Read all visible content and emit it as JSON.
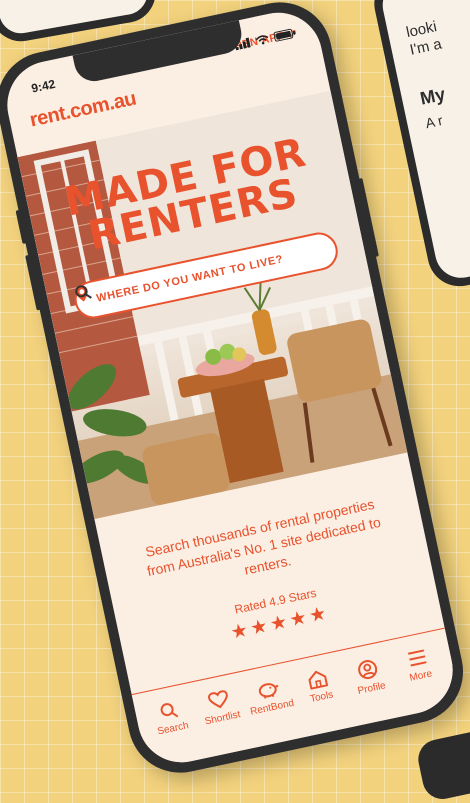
{
  "status": {
    "time": "9:42"
  },
  "header": {
    "logo": "rent.com.au",
    "open_app": "OPEN APP ↗"
  },
  "hero": {
    "headline_line1": "MADE FOR",
    "headline_line2": "RENTERS",
    "search_placeholder": "WHERE DO YOU WANT TO LIVE?"
  },
  "content": {
    "tagline": "Search thousands of rental properties from Australia's No. 1 site dedicated to renters.",
    "rating": "Rated 4.9 Stars",
    "stars": "★★★★★",
    "star_value": 5
  },
  "tabs": [
    {
      "label": "Search",
      "icon": "search-icon"
    },
    {
      "label": "Shortlist",
      "icon": "heart-icon"
    },
    {
      "label": "RentBond",
      "icon": "piggy-bank-icon"
    },
    {
      "label": "Tools",
      "icon": "home-icon"
    },
    {
      "label": "Profile",
      "icon": "user-icon"
    },
    {
      "label": "More",
      "icon": "menu-icon"
    }
  ],
  "side_phone": {
    "line1": "looki",
    "line2": "I'm a",
    "heading": "My",
    "sub": "A r"
  },
  "colors": {
    "accent": "#e8522d",
    "screen_bg": "#fbeee3",
    "page_bg": "#f2d27d"
  }
}
